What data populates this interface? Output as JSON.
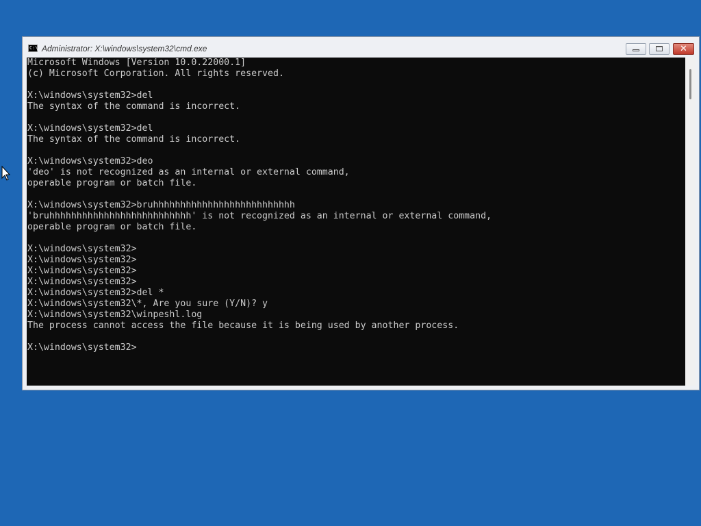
{
  "window": {
    "title": "Administrator: X:\\windows\\system32\\cmd.exe",
    "icon_text": "C:\\",
    "close_glyph": "✕"
  },
  "console": {
    "lines": [
      "Microsoft Windows [Version 10.0.22000.1]",
      "(c) Microsoft Corporation. All rights reserved.",
      "",
      "X:\\windows\\system32>del",
      "The syntax of the command is incorrect.",
      "",
      "X:\\windows\\system32>del",
      "The syntax of the command is incorrect.",
      "",
      "X:\\windows\\system32>deo",
      "'deo' is not recognized as an internal or external command,",
      "operable program or batch file.",
      "",
      "X:\\windows\\system32>bruhhhhhhhhhhhhhhhhhhhhhhhhhh",
      "'bruhhhhhhhhhhhhhhhhhhhhhhhhhh' is not recognized as an internal or external command,",
      "operable program or batch file.",
      "",
      "X:\\windows\\system32>",
      "X:\\windows\\system32>",
      "X:\\windows\\system32>",
      "X:\\windows\\system32>",
      "X:\\windows\\system32>del *",
      "X:\\windows\\system32\\*, Are you sure (Y/N)? y",
      "X:\\windows\\system32\\winpeshl.log",
      "The process cannot access the file because it is being used by another process.",
      "",
      "X:\\windows\\system32>"
    ]
  }
}
